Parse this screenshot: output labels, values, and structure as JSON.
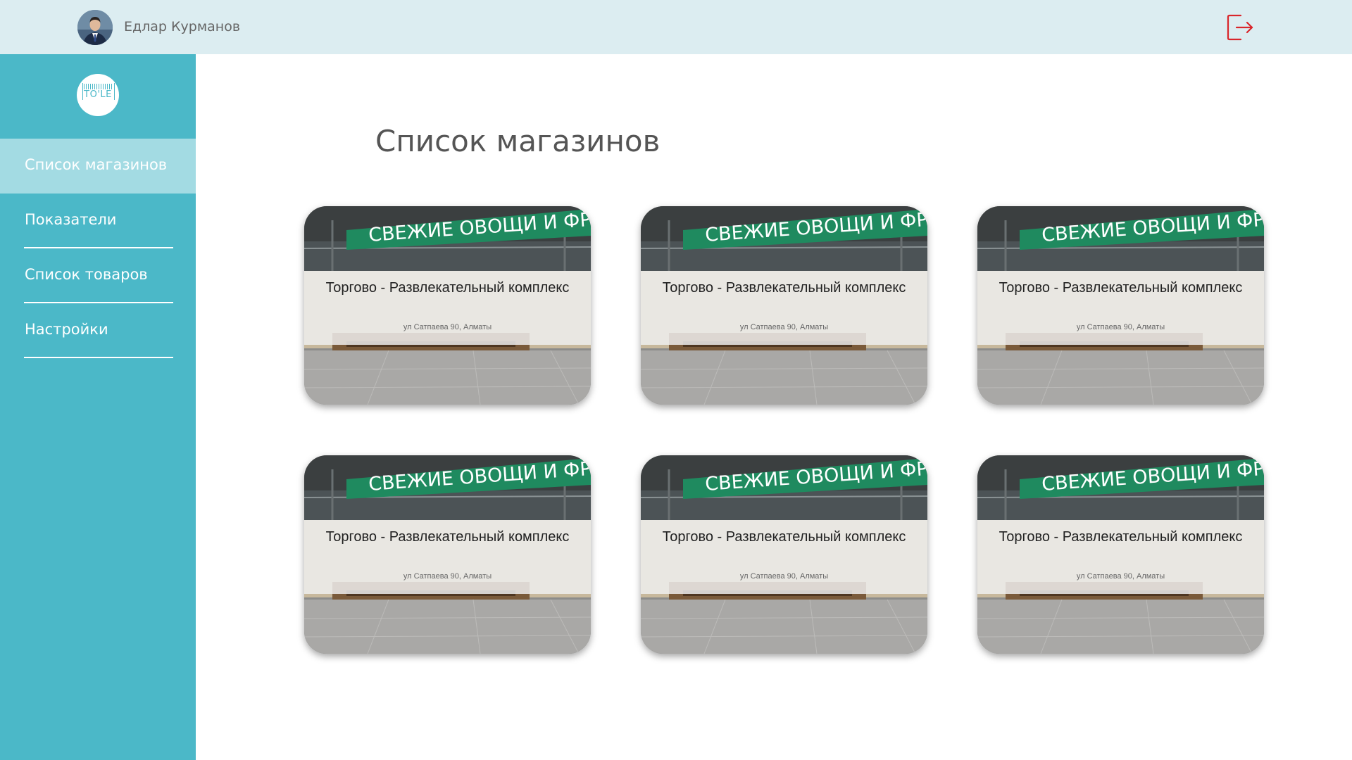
{
  "header": {
    "user_name": "Едлар Курманов",
    "avatar_icon": "user-avatar",
    "logout_icon": "logout-icon",
    "logout_color": "#d9262b"
  },
  "sidebar": {
    "logo_text": "TO'LE",
    "background": "#4bb8c8",
    "active_background": "#a3dbe3",
    "items": [
      {
        "label": "Список магазинов",
        "active": true
      },
      {
        "label": "Показатели",
        "active": false
      },
      {
        "label": "Список товаров",
        "active": false
      },
      {
        "label": "Настройки",
        "active": false
      }
    ]
  },
  "main": {
    "title": "Список магазинов",
    "stores": [
      {
        "title": "Торгово - Развлекательный комплекс",
        "address": "ул Сатпаева 90, Алматы",
        "image_text": "СВЕЖИЕ ОВОЩИ И ФРУ"
      },
      {
        "title": "Торгово - Развлекательный комплекс",
        "address": "ул Сатпаева 90, Алматы",
        "image_text": "СВЕЖИЕ ОВОЩИ И ФРУ"
      },
      {
        "title": "Торгово - Развлекательный комплекс",
        "address": "ул Сатпаева 90, Алматы",
        "image_text": "СВЕЖИЕ ОВОЩИ И ФРУ"
      },
      {
        "title": "Торгово - Развлекательный комплекс",
        "address": "ул Сатпаева 90, Алматы",
        "image_text": "СВЕЖИЕ ОВОЩИ И ФРУ"
      },
      {
        "title": "Торгово - Развлекательный комплекс",
        "address": "ул Сатпаева 90, Алматы",
        "image_text": "СВЕЖИЕ ОВОЩИ И ФРУ"
      },
      {
        "title": "Торгово - Развлекательный комплекс",
        "address": "ул Сатпаева 90, Алматы",
        "image_text": "СВЕЖИЕ ОВОЩИ И ФРУ"
      }
    ]
  }
}
